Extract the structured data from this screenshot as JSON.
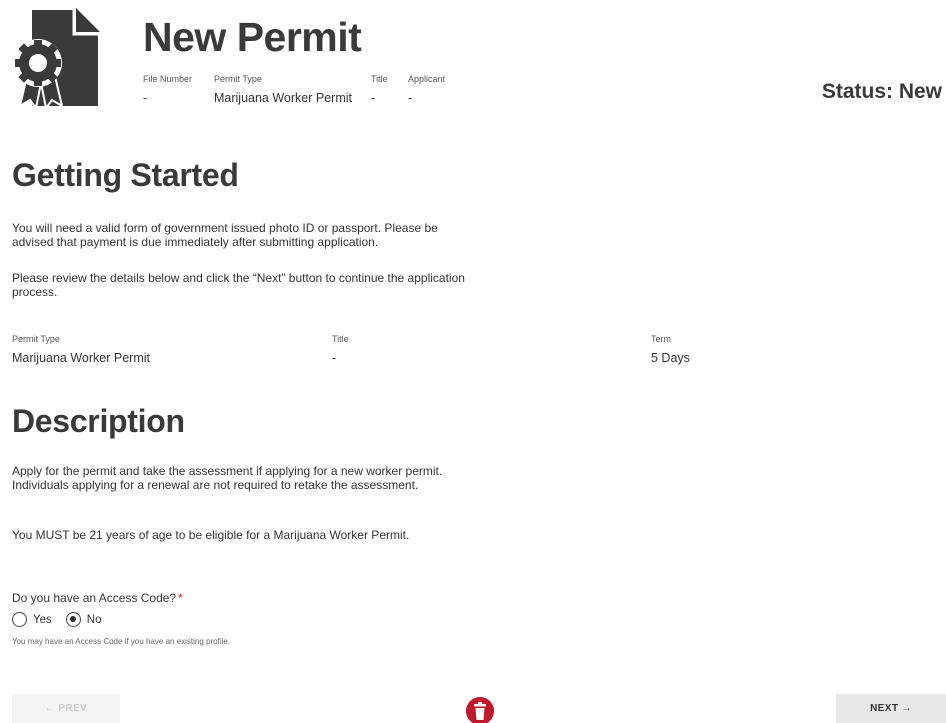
{
  "header": {
    "title": "New Permit",
    "status": "Status: New",
    "fields": [
      {
        "label": "File Number",
        "value": "-"
      },
      {
        "label": "Permit Type",
        "value": "Marijuana Worker Permit"
      },
      {
        "label": "Title",
        "value": "-"
      },
      {
        "label": "Applicant",
        "value": "-"
      }
    ]
  },
  "getting_started": {
    "heading": "Getting Started",
    "paragraph1": "You will need a valid form of government issued photo ID or passport. Please be advised that payment is due immediately after submitting application.",
    "paragraph2": "Please review the details below and click the “Next” button to continue the application process."
  },
  "details": [
    {
      "label": "Permit Type",
      "value": "Marijuana Worker Permit"
    },
    {
      "label": "Title",
      "value": "-"
    },
    {
      "label": "Term",
      "value": "5 Days"
    }
  ],
  "description": {
    "heading": "Description",
    "paragraph1": "Apply for the permit and take the assessment if applying for a new worker permit. Individuals applying for a renewal are not required to retake the assessment.",
    "paragraph2": "You MUST be 21 years of age to be eligible for a Marijuana Worker Permit."
  },
  "access_code": {
    "question": "Do you have an Access Code?",
    "required_mark": "*",
    "options": [
      {
        "label": "Yes",
        "selected": false
      },
      {
        "label": "No",
        "selected": true
      }
    ],
    "hint": "You may have an Access Code if you have an existing profile."
  },
  "footer": {
    "prev_label": "← PREV",
    "next_label": "NEXT →"
  },
  "colors": {
    "accent_red": "#c0192b",
    "icon_dark": "#3a3a3a"
  },
  "icons": {
    "permit": "document-badge-icon",
    "delete": "trash-icon"
  }
}
